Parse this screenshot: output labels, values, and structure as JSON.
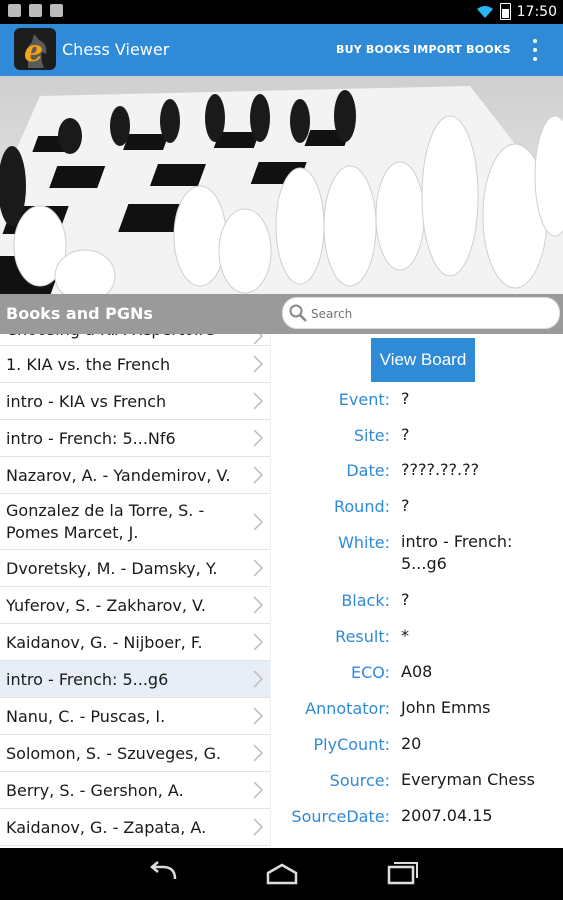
{
  "status": {
    "time": "17:50"
  },
  "actionbar": {
    "title": "Chess Viewer",
    "buy_label": "BUY BOOKS",
    "import_label": "IMPORT BOOKS"
  },
  "section": {
    "title": "Books and PGNs",
    "search_placeholder": "Search"
  },
  "list": {
    "items": [
      {
        "label": "Choosing a KIA Repertoire"
      },
      {
        "label": "1. KIA vs. the French"
      },
      {
        "label": "intro - KIA vs French"
      },
      {
        "label": "intro - French: 5...Nf6"
      },
      {
        "label": "Nazarov, A. - Yandemirov, V."
      },
      {
        "label": "Gonzalez de la Torre, S. - Pomes Marcet, J."
      },
      {
        "label": "Dvoretsky, M. - Damsky, Y."
      },
      {
        "label": "Yuferov, S. - Zakharov, V."
      },
      {
        "label": "Kaidanov, G. - Nijboer, F."
      },
      {
        "label": "intro - French: 5...g6",
        "selected": true
      },
      {
        "label": "Nanu, C. - Puscas, I."
      },
      {
        "label": "Solomon, S. - Szuveges, G."
      },
      {
        "label": "Berry, S. - Gershon, A."
      },
      {
        "label": "Kaidanov, G. - Zapata, A."
      }
    ]
  },
  "detail": {
    "view_board_label": "View Board",
    "fields": [
      {
        "key": "Event:",
        "value": "?"
      },
      {
        "key": "Site:",
        "value": "?"
      },
      {
        "key": "Date:",
        "value": "????.??.??"
      },
      {
        "key": "Round:",
        "value": "?"
      },
      {
        "key": "White:",
        "value": "intro - French: 5...g6"
      },
      {
        "key": "Black:",
        "value": "?"
      },
      {
        "key": "Result:",
        "value": "*"
      },
      {
        "key": "ECO:",
        "value": "A08"
      },
      {
        "key": "Annotator:",
        "value": "John Emms"
      },
      {
        "key": "PlyCount:",
        "value": "20"
      },
      {
        "key": "Source:",
        "value": "Everyman Chess"
      },
      {
        "key": "SourceDate:",
        "value": "2007.04.15"
      }
    ]
  },
  "colors": {
    "accent": "#2f8ad8",
    "selected_row": "#e8eef7"
  },
  "icons": [
    "gmail-icon",
    "mail-icon",
    "image-icon",
    "wifi-icon",
    "battery-icon",
    "app-logo-icon",
    "overflow-menu-icon",
    "search-icon",
    "chevron-right-icon",
    "back-icon",
    "home-icon",
    "recent-apps-icon"
  ]
}
